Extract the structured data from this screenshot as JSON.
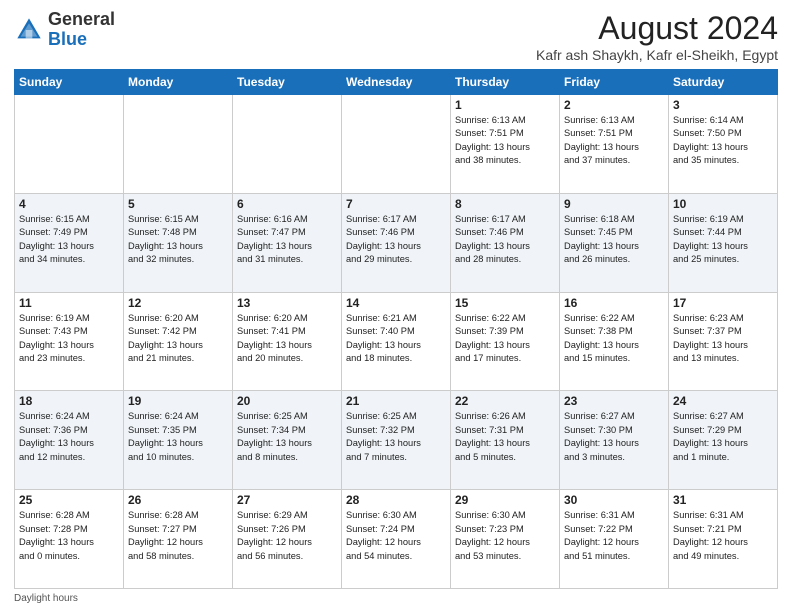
{
  "header": {
    "logo_general": "General",
    "logo_blue": "Blue",
    "month_title": "August 2024",
    "location": "Kafr ash Shaykh, Kafr el-Sheikh, Egypt"
  },
  "days_of_week": [
    "Sunday",
    "Monday",
    "Tuesday",
    "Wednesday",
    "Thursday",
    "Friday",
    "Saturday"
  ],
  "footer": {
    "daylight_label": "Daylight hours"
  },
  "weeks": [
    {
      "days": [
        {
          "num": "",
          "info": ""
        },
        {
          "num": "",
          "info": ""
        },
        {
          "num": "",
          "info": ""
        },
        {
          "num": "",
          "info": ""
        },
        {
          "num": "1",
          "info": "Sunrise: 6:13 AM\nSunset: 7:51 PM\nDaylight: 13 hours\nand 38 minutes."
        },
        {
          "num": "2",
          "info": "Sunrise: 6:13 AM\nSunset: 7:51 PM\nDaylight: 13 hours\nand 37 minutes."
        },
        {
          "num": "3",
          "info": "Sunrise: 6:14 AM\nSunset: 7:50 PM\nDaylight: 13 hours\nand 35 minutes."
        }
      ]
    },
    {
      "days": [
        {
          "num": "4",
          "info": "Sunrise: 6:15 AM\nSunset: 7:49 PM\nDaylight: 13 hours\nand 34 minutes."
        },
        {
          "num": "5",
          "info": "Sunrise: 6:15 AM\nSunset: 7:48 PM\nDaylight: 13 hours\nand 32 minutes."
        },
        {
          "num": "6",
          "info": "Sunrise: 6:16 AM\nSunset: 7:47 PM\nDaylight: 13 hours\nand 31 minutes."
        },
        {
          "num": "7",
          "info": "Sunrise: 6:17 AM\nSunset: 7:46 PM\nDaylight: 13 hours\nand 29 minutes."
        },
        {
          "num": "8",
          "info": "Sunrise: 6:17 AM\nSunset: 7:46 PM\nDaylight: 13 hours\nand 28 minutes."
        },
        {
          "num": "9",
          "info": "Sunrise: 6:18 AM\nSunset: 7:45 PM\nDaylight: 13 hours\nand 26 minutes."
        },
        {
          "num": "10",
          "info": "Sunrise: 6:19 AM\nSunset: 7:44 PM\nDaylight: 13 hours\nand 25 minutes."
        }
      ]
    },
    {
      "days": [
        {
          "num": "11",
          "info": "Sunrise: 6:19 AM\nSunset: 7:43 PM\nDaylight: 13 hours\nand 23 minutes."
        },
        {
          "num": "12",
          "info": "Sunrise: 6:20 AM\nSunset: 7:42 PM\nDaylight: 13 hours\nand 21 minutes."
        },
        {
          "num": "13",
          "info": "Sunrise: 6:20 AM\nSunset: 7:41 PM\nDaylight: 13 hours\nand 20 minutes."
        },
        {
          "num": "14",
          "info": "Sunrise: 6:21 AM\nSunset: 7:40 PM\nDaylight: 13 hours\nand 18 minutes."
        },
        {
          "num": "15",
          "info": "Sunrise: 6:22 AM\nSunset: 7:39 PM\nDaylight: 13 hours\nand 17 minutes."
        },
        {
          "num": "16",
          "info": "Sunrise: 6:22 AM\nSunset: 7:38 PM\nDaylight: 13 hours\nand 15 minutes."
        },
        {
          "num": "17",
          "info": "Sunrise: 6:23 AM\nSunset: 7:37 PM\nDaylight: 13 hours\nand 13 minutes."
        }
      ]
    },
    {
      "days": [
        {
          "num": "18",
          "info": "Sunrise: 6:24 AM\nSunset: 7:36 PM\nDaylight: 13 hours\nand 12 minutes."
        },
        {
          "num": "19",
          "info": "Sunrise: 6:24 AM\nSunset: 7:35 PM\nDaylight: 13 hours\nand 10 minutes."
        },
        {
          "num": "20",
          "info": "Sunrise: 6:25 AM\nSunset: 7:34 PM\nDaylight: 13 hours\nand 8 minutes."
        },
        {
          "num": "21",
          "info": "Sunrise: 6:25 AM\nSunset: 7:32 PM\nDaylight: 13 hours\nand 7 minutes."
        },
        {
          "num": "22",
          "info": "Sunrise: 6:26 AM\nSunset: 7:31 PM\nDaylight: 13 hours\nand 5 minutes."
        },
        {
          "num": "23",
          "info": "Sunrise: 6:27 AM\nSunset: 7:30 PM\nDaylight: 13 hours\nand 3 minutes."
        },
        {
          "num": "24",
          "info": "Sunrise: 6:27 AM\nSunset: 7:29 PM\nDaylight: 13 hours\nand 1 minute."
        }
      ]
    },
    {
      "days": [
        {
          "num": "25",
          "info": "Sunrise: 6:28 AM\nSunset: 7:28 PM\nDaylight: 13 hours\nand 0 minutes."
        },
        {
          "num": "26",
          "info": "Sunrise: 6:28 AM\nSunset: 7:27 PM\nDaylight: 12 hours\nand 58 minutes."
        },
        {
          "num": "27",
          "info": "Sunrise: 6:29 AM\nSunset: 7:26 PM\nDaylight: 12 hours\nand 56 minutes."
        },
        {
          "num": "28",
          "info": "Sunrise: 6:30 AM\nSunset: 7:24 PM\nDaylight: 12 hours\nand 54 minutes."
        },
        {
          "num": "29",
          "info": "Sunrise: 6:30 AM\nSunset: 7:23 PM\nDaylight: 12 hours\nand 53 minutes."
        },
        {
          "num": "30",
          "info": "Sunrise: 6:31 AM\nSunset: 7:22 PM\nDaylight: 12 hours\nand 51 minutes."
        },
        {
          "num": "31",
          "info": "Sunrise: 6:31 AM\nSunset: 7:21 PM\nDaylight: 12 hours\nand 49 minutes."
        }
      ]
    }
  ]
}
